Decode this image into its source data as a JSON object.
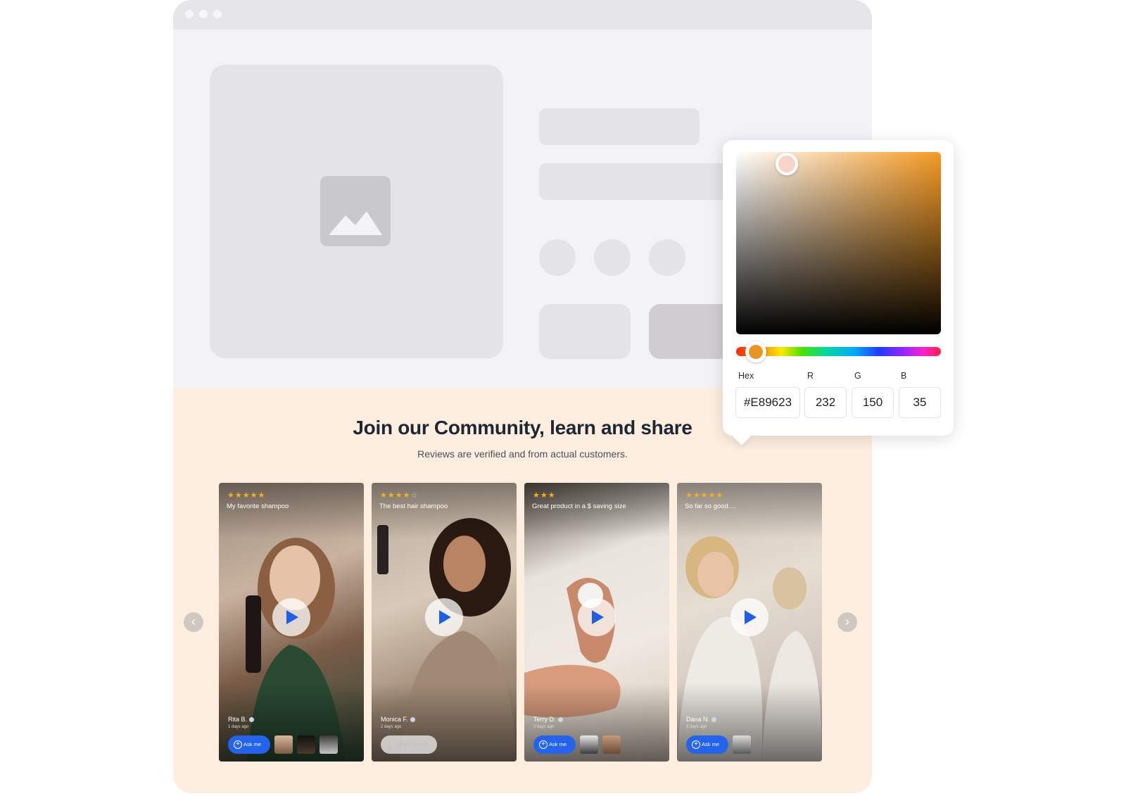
{
  "community": {
    "title": "Join our Community, learn and share",
    "subtitle": "Reviews are verified and from actual customers.",
    "prev_icon": "chevron-left-icon",
    "next_icon": "chevron-right-icon"
  },
  "reviews": [
    {
      "rating": 5,
      "stars_on": "★★★★★",
      "stars_off": "",
      "caption": "My favorite shampoo",
      "name": "Rita B.",
      "time": "1 days ago",
      "action": "Ask me"
    },
    {
      "rating": 4,
      "stars_on": "★★★★",
      "stars_off": "☆",
      "caption": "The best hair shampoo",
      "name": "Monica F.",
      "time": "2 days ago",
      "action": "Reply closed"
    },
    {
      "rating": 3,
      "stars_on": "★★★",
      "stars_off": "",
      "caption": "Great product in a $ saving size",
      "name": "Terry D.",
      "time": "2 days ago",
      "action": "Ask me"
    },
    {
      "rating": 5,
      "stars_on": "★★★★★",
      "stars_off": "",
      "caption": "So far so good....",
      "name": "Dana N.",
      "time": "3 days ago",
      "action": "Ask me"
    }
  ],
  "picker": {
    "hex_label": "Hex",
    "r_label": "R",
    "g_label": "G",
    "b_label": "B",
    "hex": "#E89623",
    "r": "232",
    "g": "150",
    "b": "35",
    "selected_color": "#E89623",
    "hue_color": "#F59A24"
  },
  "colors": {
    "community_bg": "#FEEEE0",
    "accent_blue": "#2463EB",
    "star": "#F5B01F"
  }
}
